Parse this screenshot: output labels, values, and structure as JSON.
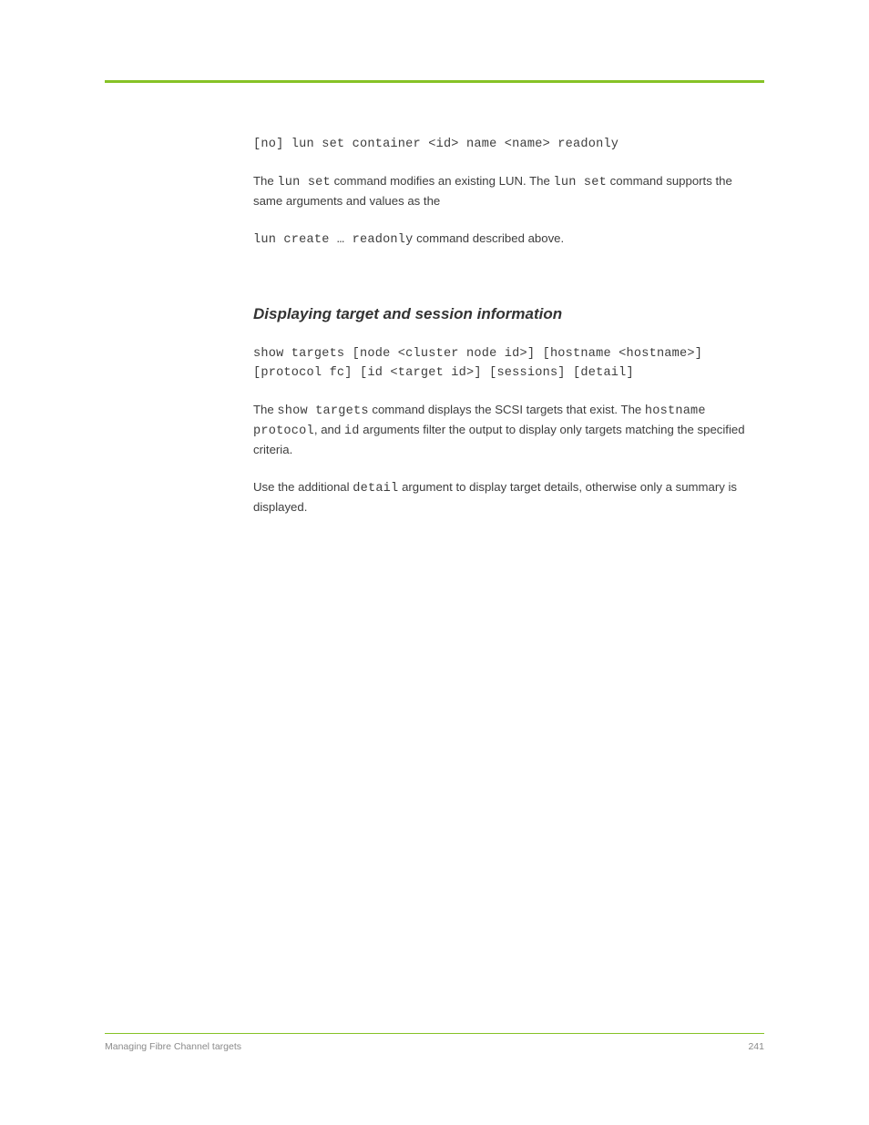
{
  "section1": {
    "cmd": "[no] lun set container <id> name <name> readonly",
    "para": {
      "pre1": "The ",
      "m1": "lun set",
      "mid": " command modifies an existing LUN. The ",
      "m2": "lun set",
      "post": " command supports the same arguments and values as the"
    },
    "cmd2_pre": "lun create … readonly",
    "cmd2_post": " command described above."
  },
  "section2": {
    "heading": "Displaying target and session information",
    "cmd_line1": "show targets [node <cluster node id>] [hostname <hostname>]",
    "cmd_line2": "[protocol fc] [id <target id>] [sessions] [detail]",
    "para1": {
      "pre": "The ",
      "m1": "show targets",
      "mid1": " command displays the SCSI targets that exist. The ",
      "m_hostname": "hostname",
      "m_protocol": "protocol",
      "m_and": ", and ",
      "m_id": "id",
      "post": " arguments filter the output to display only targets matching the specified criteria."
    },
    "para2": {
      "pre": "Use the additional ",
      "m_detail": "detail",
      "post": " argument to display target details, otherwise only a summary is displayed."
    }
  },
  "footer": {
    "left": "Managing Fibre Channel targets",
    "right": "241"
  }
}
